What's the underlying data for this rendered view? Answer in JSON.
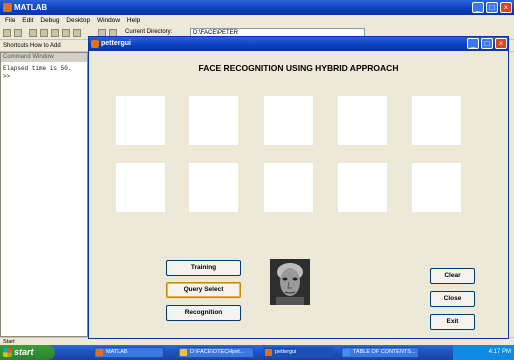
{
  "matlab": {
    "title": "MATLAB",
    "menu": [
      "File",
      "Edit",
      "Debug",
      "Desktop",
      "Window",
      "Help"
    ],
    "current_directory_label": "Current Directory:",
    "current_directory": "D:\\FACE\\PETER",
    "shortcuts": "Shortcuts  How to Add",
    "command_window_title": "Command Window",
    "command_lines": [
      "Elapsed time is 50.",
      ">>"
    ],
    "start_label": "Start"
  },
  "gui": {
    "title": "pettergui",
    "heading": "FACE RECOGNITION USING HYBRID APPROACH",
    "buttons": {
      "training": "Training",
      "query_select": "Query Select",
      "recognition": "Recognition",
      "clear": "Clear",
      "close": "Close",
      "exit": "Exit"
    }
  },
  "taskbar": {
    "start": "start",
    "items": [
      "MATLAB",
      "D:\\FACE\\OTECHpet...",
      "pettergui",
      "TABLE OF CONTENTS..."
    ],
    "clock": "4:17 PM"
  },
  "colors": {
    "titlebar": "#0a3fc0",
    "window_bg": "#ece9d8",
    "taskbar": "#1f55c0",
    "start_button": "#2d822d"
  }
}
